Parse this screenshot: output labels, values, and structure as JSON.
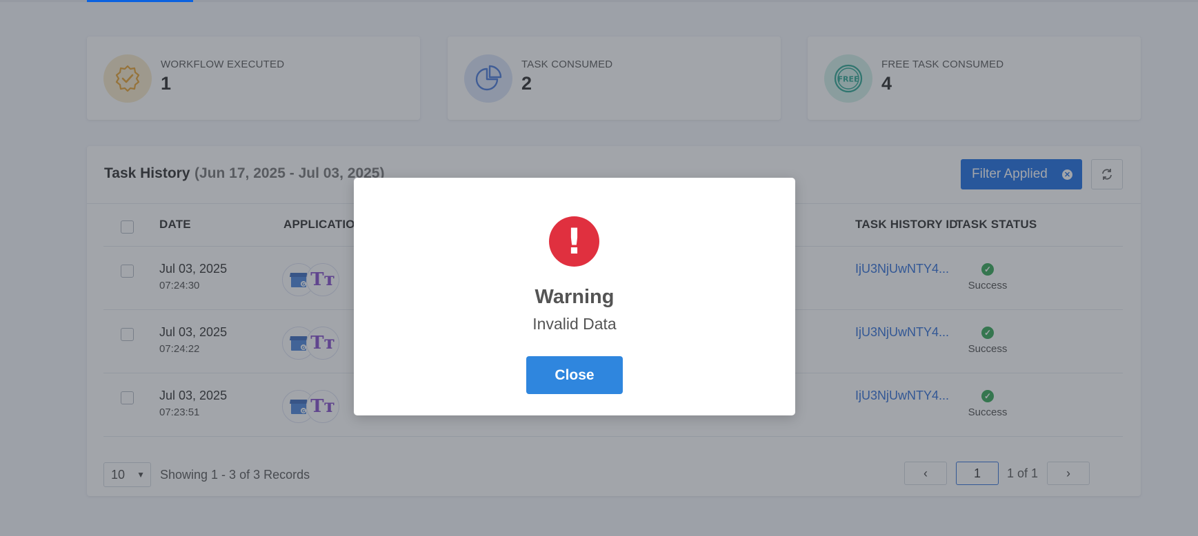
{
  "stats": [
    {
      "label": "WORKFLOW EXECUTED",
      "value": "1",
      "icon": "badge-check-icon",
      "circle_color": "#f6e7c4",
      "icon_color": "#e69a1e"
    },
    {
      "label": "TASK CONSUMED",
      "value": "2",
      "icon": "pie-chart-icon",
      "circle_color": "#d7e1f6",
      "icon_color": "#3a6ed6"
    },
    {
      "label": "FREE TASK CONSUMED",
      "value": "4",
      "icon": "free-badge-icon",
      "circle_color": "#cfeee6",
      "icon_color": "#1a9e88"
    }
  ],
  "history": {
    "title": "Task History",
    "range": "(Jun 17, 2025 - Jul 03, 2025)",
    "filter_label": "Filter Applied",
    "columns": {
      "date": "DATE",
      "application": "APPLICATIO",
      "task_history_id": "TASK HISTORY ID",
      "task_status": "TASK STATUS"
    },
    "rows": [
      {
        "date": "Jul 03, 2025",
        "time": "07:24:30",
        "id": "IjU3NjUwNTY4...",
        "status": "Success"
      },
      {
        "date": "Jul 03, 2025",
        "time": "07:24:22",
        "id": "IjU3NjUwNTY4...",
        "status": "Success"
      },
      {
        "date": "Jul 03, 2025",
        "time": "07:23:51",
        "id": "IjU3NjUwNTY4...",
        "status": "Success"
      }
    ],
    "per_page": "10",
    "records_text": "Showing 1 - 3 of 3 Records",
    "page_input": "1",
    "page_of": "1 of 1"
  },
  "modal": {
    "title": "Warning",
    "message": "Invalid Data",
    "button": "Close"
  },
  "colors": {
    "primary": "#0b62e0",
    "link": "#1f63d4",
    "success": "#24a148",
    "danger": "#e0303f",
    "modal_button": "#2f86de"
  }
}
